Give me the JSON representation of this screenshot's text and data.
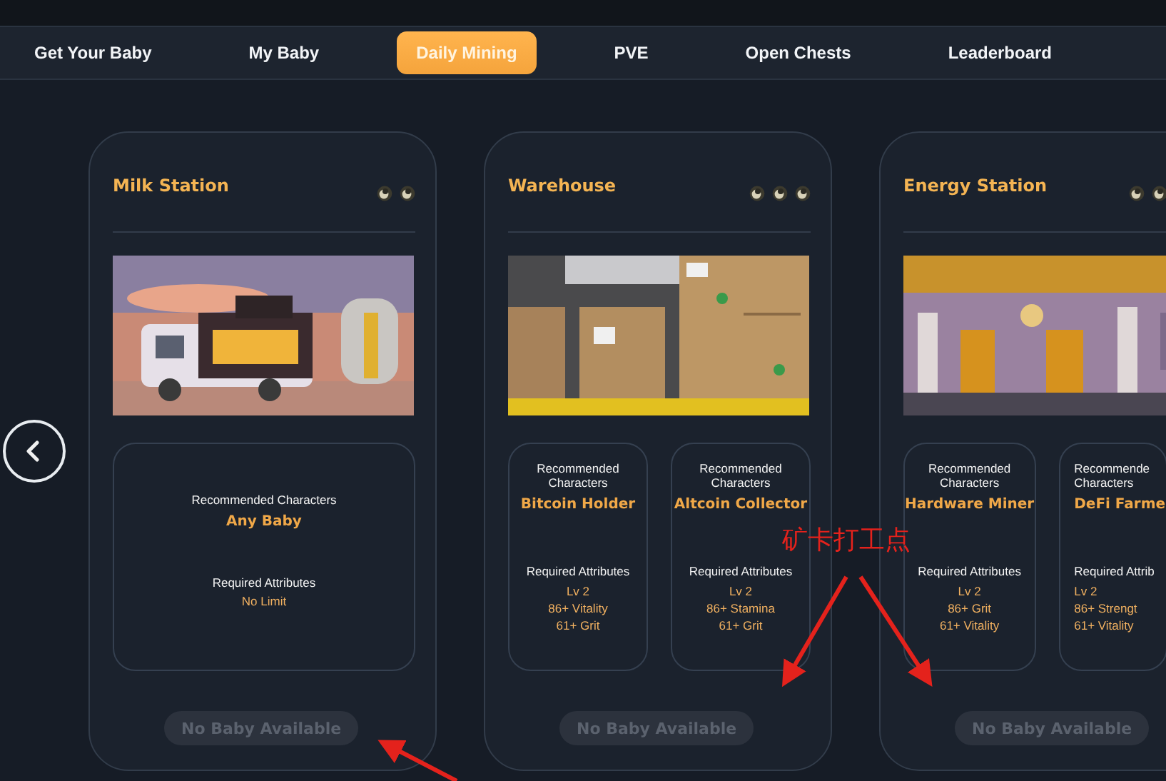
{
  "tabs": [
    {
      "label": "Get Your Baby",
      "selected": false
    },
    {
      "label": "My Baby",
      "selected": false
    },
    {
      "label": "Daily Mining",
      "selected": true
    },
    {
      "label": "PVE",
      "selected": false
    },
    {
      "label": "Open Chests",
      "selected": false
    },
    {
      "label": "Leaderboard",
      "selected": false
    }
  ],
  "stations": [
    {
      "title": "Milk Station",
      "coins": [
        {
          "kind": "coin"
        },
        {
          "kind": "coin"
        }
      ],
      "picture": {
        "kind": "truck"
      },
      "cut": false,
      "slots": [
        {
          "heading": "Recommended Characters",
          "character": "Any Baby",
          "attributes_heading": "Required Attributes",
          "attributes": [
            "No Limit"
          ]
        }
      ],
      "button": {
        "label": "No Baby Available",
        "disabled": true
      }
    },
    {
      "title": "Warehouse",
      "coins": [
        {
          "kind": "coin"
        },
        {
          "kind": "coin"
        },
        {
          "kind": "coin"
        }
      ],
      "picture": {
        "kind": "boxes"
      },
      "cut": false,
      "slots": [
        {
          "heading": "Recommended Characters",
          "character": "Bitcoin Holder",
          "attributes_heading": "Required Attributes",
          "attributes": [
            "Lv 2",
            "86+ Vitality",
            "61+ Grit"
          ]
        },
        {
          "heading": "Recommended Characters",
          "character": "Altcoin Collector",
          "attributes_heading": "Required Attributes",
          "attributes": [
            "Lv 2",
            "86+ Stamina",
            "61+ Grit"
          ]
        }
      ],
      "button": {
        "label": "No Baby Available",
        "disabled": true
      }
    },
    {
      "title": "Energy Station",
      "coins": [
        {
          "kind": "coin"
        },
        {
          "kind": "coin"
        }
      ],
      "picture": {
        "kind": "station"
      },
      "cut": true,
      "slots": [
        {
          "heading": "Recommended Characters",
          "character": "Hardware Miner",
          "attributes_heading": "Required Attributes",
          "attributes": [
            "Lv 2",
            "86+ Grit",
            "61+ Vitality"
          ]
        },
        {
          "heading": "Recommende Characters",
          "character": "DeFi Farme",
          "attributes_heading": "Required Attrib",
          "attributes": [
            "Lv 2",
            "86+ Strengt",
            "61+ Vitality"
          ]
        }
      ],
      "button": {
        "label": "No Baby Available",
        "disabled": true
      }
    }
  ],
  "annotation": {
    "text": "矿卡打工点"
  }
}
